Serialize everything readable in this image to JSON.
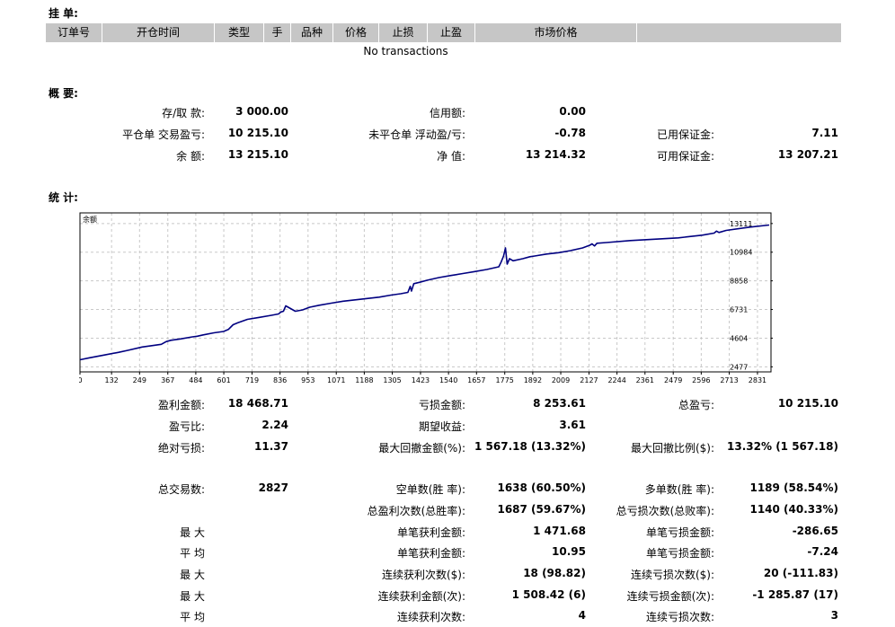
{
  "pending": {
    "title": "挂 单:",
    "columns": [
      "订单号",
      "开仓时间",
      "类型",
      "手",
      "品种",
      "价格",
      "止损",
      "止盈",
      "市场价格",
      ""
    ],
    "empty": "No transactions"
  },
  "summary": {
    "title": "概 要:",
    "rows": [
      [
        {
          "l": "存/取 款:",
          "v": "3 000.00"
        },
        {
          "l": "信用额:",
          "v": "0.00"
        },
        {
          "l": "",
          "v": ""
        }
      ],
      [
        {
          "l": "平仓单 交易盈亏:",
          "v": "10 215.10"
        },
        {
          "l": "未平仓单 浮动盈/亏:",
          "v": "-0.78"
        },
        {
          "l": "已用保证金:",
          "v": "7.11"
        }
      ],
      [
        {
          "l": "余 额:",
          "v": "13 215.10"
        },
        {
          "l": "净 值:",
          "v": "13 214.32"
        },
        {
          "l": "可用保证金:",
          "v": "13 207.21"
        }
      ]
    ]
  },
  "stats": {
    "title": "统 计:",
    "rows": [
      [
        {
          "l": "盈利金额:",
          "v": "18 468.71"
        },
        {
          "l": "亏损金额:",
          "v": "8 253.61"
        },
        {
          "l": "总盈亏:",
          "v": "10 215.10"
        }
      ],
      [
        {
          "l": "盈亏比:",
          "v": "2.24"
        },
        {
          "l": "期望收益:",
          "v": "3.61"
        },
        {
          "l": "",
          "v": ""
        }
      ],
      [
        {
          "l": "绝对亏损:",
          "v": "11.37"
        },
        {
          "l": "最大回撤金额(%):",
          "v": "1 567.18 (13.32%)"
        },
        {
          "l": "最大回撤比例($):",
          "v": "13.32% (1 567.18)"
        }
      ],
      [
        {
          "l": "总交易数:",
          "v": "2827"
        },
        {
          "l": "空单数(胜 率):",
          "v": "1638 (60.50%)"
        },
        {
          "l": "多单数(胜 率):",
          "v": "1189 (58.54%)"
        }
      ],
      [
        {
          "l": "",
          "v": ""
        },
        {
          "l": "总盈利次数(总胜率):",
          "v": "1687 (59.67%)"
        },
        {
          "l": "总亏损次数(总败率):",
          "v": "1140 (40.33%)"
        }
      ],
      [
        {
          "l": "最 大",
          "v": ""
        },
        {
          "l": "单笔获利金额:",
          "v": "1 471.68"
        },
        {
          "l": "单笔亏损金额:",
          "v": "-286.65"
        }
      ],
      [
        {
          "l": "平 均",
          "v": ""
        },
        {
          "l": "单笔获利金额:",
          "v": "10.95"
        },
        {
          "l": "单笔亏损金额:",
          "v": "-7.24"
        }
      ],
      [
        {
          "l": "最 大",
          "v": ""
        },
        {
          "l": "连续获利次数($):",
          "v": "18 (98.82)"
        },
        {
          "l": "连续亏损次数($):",
          "v": "20 (-111.83)"
        }
      ],
      [
        {
          "l": "最 大",
          "v": ""
        },
        {
          "l": "连续获利金额(次):",
          "v": "1 508.42 (6)"
        },
        {
          "l": "连续亏损金额(次):",
          "v": "-1 285.87 (17)"
        }
      ],
      [
        {
          "l": "平 均",
          "v": ""
        },
        {
          "l": "连续获利次数:",
          "v": "4"
        },
        {
          "l": "连续亏损次数:",
          "v": "3"
        }
      ]
    ]
  },
  "chart_data": {
    "type": "line",
    "title": "余额",
    "xlabel": "",
    "ylabel": "",
    "x_ticks": [
      0,
      132,
      249,
      367,
      484,
      601,
      719,
      836,
      953,
      1071,
      1188,
      1305,
      1423,
      1540,
      1657,
      1775,
      1892,
      2009,
      2127,
      2244,
      2361,
      2479,
      2596,
      2713,
      2831
    ],
    "y_ticks": [
      2477,
      4604,
      6731,
      8858,
      10984,
      13111
    ],
    "xlim": [
      0,
      2880
    ],
    "ylim": [
      2100,
      13900
    ],
    "grid": true,
    "colors": {
      "line": "#000080",
      "grid": "#c8c8c8",
      "frame": "#000000"
    },
    "series": [
      {
        "name": "余额",
        "x": [
          0,
          40,
          100,
          160,
          200,
          260,
          300,
          340,
          360,
          380,
          420,
          470,
          490,
          515,
          560,
          600,
          620,
          640,
          660,
          700,
          750,
          800,
          830,
          840,
          850,
          860,
          900,
          930,
          960,
          1000,
          1050,
          1100,
          1150,
          1200,
          1250,
          1300,
          1340,
          1370,
          1380,
          1385,
          1395,
          1420,
          1450,
          1500,
          1550,
          1600,
          1650,
          1700,
          1750,
          1760,
          1770,
          1778,
          1785,
          1795,
          1810,
          1850,
          1880,
          1900,
          1950,
          2000,
          2050,
          2100,
          2130,
          2140,
          2150,
          2160,
          2200,
          2300,
          2400,
          2500,
          2600,
          2650,
          2660,
          2670,
          2700,
          2800,
          2880
        ],
        "y": [
          3000,
          3150,
          3350,
          3550,
          3700,
          3950,
          4050,
          4150,
          4350,
          4450,
          4550,
          4700,
          4750,
          4850,
          5000,
          5100,
          5250,
          5600,
          5750,
          6000,
          6150,
          6300,
          6400,
          6550,
          6600,
          7000,
          6600,
          6700,
          6900,
          7050,
          7200,
          7350,
          7450,
          7550,
          7650,
          7800,
          7900,
          8000,
          8450,
          8100,
          8650,
          8750,
          8900,
          9100,
          9250,
          9400,
          9550,
          9700,
          9900,
          10250,
          10700,
          11300,
          10100,
          10500,
          10350,
          10500,
          10650,
          10700,
          10850,
          10950,
          11100,
          11300,
          11500,
          11600,
          11450,
          11650,
          11700,
          11850,
          11950,
          12050,
          12250,
          12400,
          12550,
          12450,
          12600,
          12850,
          13000
        ]
      }
    ]
  }
}
